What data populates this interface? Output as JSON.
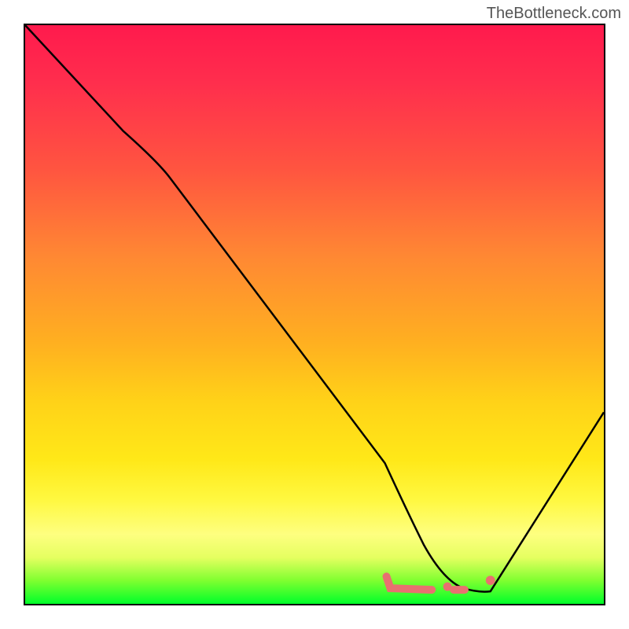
{
  "watermark": "TheBottleneck.com",
  "chart_data": {
    "type": "line",
    "title": "",
    "xlabel": "",
    "ylabel": "",
    "xlim": [
      0,
      100
    ],
    "ylim": [
      0,
      100
    ],
    "series": [
      {
        "name": "bottleneck-curve",
        "x": [
          0,
          17,
          25,
          62,
          67,
          73,
          78,
          80,
          82,
          100
        ],
        "values": [
          100,
          82,
          77,
          24,
          12,
          4,
          2,
          2,
          2,
          33
        ]
      }
    ],
    "markers": {
      "name": "optimal-range",
      "points": [
        {
          "x": 62,
          "y": 3
        },
        {
          "x": 63,
          "y": 2
        },
        {
          "x": 70,
          "y": 2
        },
        {
          "x": 73,
          "y": 2.5
        },
        {
          "x": 76,
          "y": 2
        },
        {
          "x": 80,
          "y": 3
        }
      ]
    },
    "gradient": {
      "colors": [
        "#ff1a4d",
        "#ff8833",
        "#ffd218",
        "#fff840",
        "#00ff2a"
      ],
      "direction": "vertical"
    }
  }
}
